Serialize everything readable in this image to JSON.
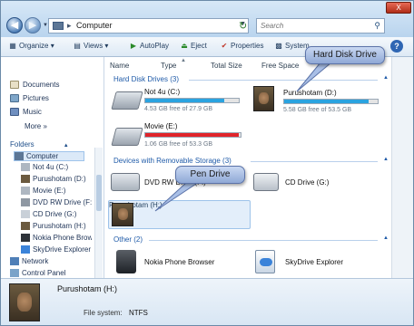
{
  "window": {
    "address": "Computer",
    "search_placeholder": "Search",
    "close_label": "X"
  },
  "toolbar": {
    "organize": "Organize",
    "views": "Views",
    "autoplay": "AutoPlay",
    "eject": "Eject",
    "properties": "Properties",
    "system": "System"
  },
  "nav": {
    "favorites": [
      "Documents",
      "Pictures",
      "Music"
    ],
    "more": "More",
    "folders": "Folders",
    "tree": [
      "Computer",
      "Not 4u (C:)",
      "Purushotam (D:)",
      "Movie (E:)",
      "DVD RW Drive (F:)",
      "CD Drive (G:)",
      "Purushotam (H:)",
      "Nokia Phone Browser",
      "SkyDrive Explorer",
      "Network",
      "Control Panel"
    ]
  },
  "columns": [
    "Name",
    "Type",
    "Total Size",
    "Free Space"
  ],
  "groups": {
    "hdd": "Hard Disk Drives (3)",
    "removable": "Devices with Removable Storage (3)",
    "other": "Other (2)"
  },
  "drives": {
    "c": {
      "name": "Not 4u (C:)",
      "free": "4.53 GB free of 27.9 GB",
      "used_fraction": 0.84
    },
    "d": {
      "name": "Purushotam (D:)",
      "free": "5.58 GB free of 53.5 GB",
      "used_fraction": 0.9
    },
    "e": {
      "name": "Movie (E:)",
      "free": "1.06 GB free of 53.3 GB",
      "used_fraction": 0.98
    },
    "f": {
      "name": "DVD RW Drive (F:)"
    },
    "g": {
      "name": "CD Drive (G:)"
    },
    "h": {
      "name": "Purushotam (H:)"
    },
    "nokia": {
      "name": "Nokia Phone Browser"
    },
    "sky": {
      "name": "SkyDrive Explorer"
    }
  },
  "callouts": {
    "hdd": "Hard Disk Drive",
    "pen": "Pen Drive"
  },
  "details": {
    "name": "Purushotam (H:)",
    "fs_label": "File system:",
    "fs_value": "NTFS"
  },
  "colors": {
    "bar_ok": "#2aa3e0",
    "bar_full": "#e0242a",
    "callout": "#a9bfe6"
  }
}
